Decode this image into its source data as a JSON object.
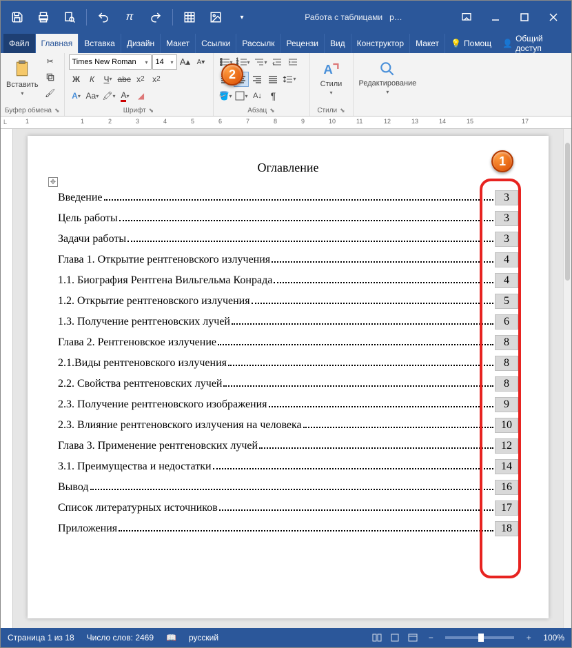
{
  "titlebar": {
    "context": "Работа с таблицами",
    "docname": "р…"
  },
  "tabs": {
    "file": "Файл",
    "home": "Главная",
    "insert": "Вставка",
    "design": "Дизайн",
    "layout": "Макет",
    "references": "Ссылки",
    "mailings": "Рассылк",
    "review": "Рецензи",
    "view": "Вид",
    "table_design": "Конструктор",
    "table_layout": "Макет",
    "help": "Помощ",
    "share": "Общий доступ"
  },
  "ribbon": {
    "clipboard": {
      "paste": "Вставить",
      "label": "Буфер обмена"
    },
    "font": {
      "name": "Times New Roman",
      "size": "14",
      "label": "Шрифт"
    },
    "paragraph": {
      "label": "Абзац"
    },
    "styles": {
      "btn": "Стили",
      "label": "Стили"
    },
    "editing": {
      "btn": "Редактирование"
    }
  },
  "document": {
    "title": "Оглавление",
    "toc": [
      {
        "text": "Введение",
        "page": "3"
      },
      {
        "text": " Цель работы",
        "page": "3"
      },
      {
        "text": "Задачи работы",
        "page": "3"
      },
      {
        "text": "Глава 1. Открытие рентгеновского излучения",
        "page": "4"
      },
      {
        "text": "1.1. Биография Рентгена Вильгельма Конрада",
        "page": "4"
      },
      {
        "text": "1.2. Открытие рентгеновского излучения ",
        "page": "5"
      },
      {
        "text": "1.3. Получение рентгеновских лучей",
        "page": "6"
      },
      {
        "text": "Глава 2. Рентгеновское излучение",
        "page": "8"
      },
      {
        "text": "2.1.Виды рентгеновского излучения",
        "page": "8"
      },
      {
        "text": "2.2. Свойства рентгеновских лучей",
        "page": "8"
      },
      {
        "text": "2.3. Получение рентгеновского изображения",
        "page": "9"
      },
      {
        "text": "2.3. Влияние рентгеновского излучения на человека",
        "page": "10"
      },
      {
        "text": "Глава 3. Применение рентгеновских лучей",
        "page": "12"
      },
      {
        "text": "3.1. Преимущества и недостатки",
        "page": "14"
      },
      {
        "text": "Вывод",
        "page": "16"
      },
      {
        "text": "Список литературных источников",
        "page": "17"
      },
      {
        "text": "Приложения",
        "page": "18"
      }
    ]
  },
  "statusbar": {
    "page": "Страница 1 из 18",
    "words": "Число слов: 2469",
    "lang": "русский",
    "zoom": "100%"
  },
  "callouts": {
    "n1": "1",
    "n2": "2"
  },
  "ruler": [
    "1",
    "",
    "1",
    "2",
    "3",
    "4",
    "5",
    "6",
    "7",
    "8",
    "9",
    "10",
    "11",
    "12",
    "13",
    "14",
    "15",
    "",
    "17"
  ]
}
